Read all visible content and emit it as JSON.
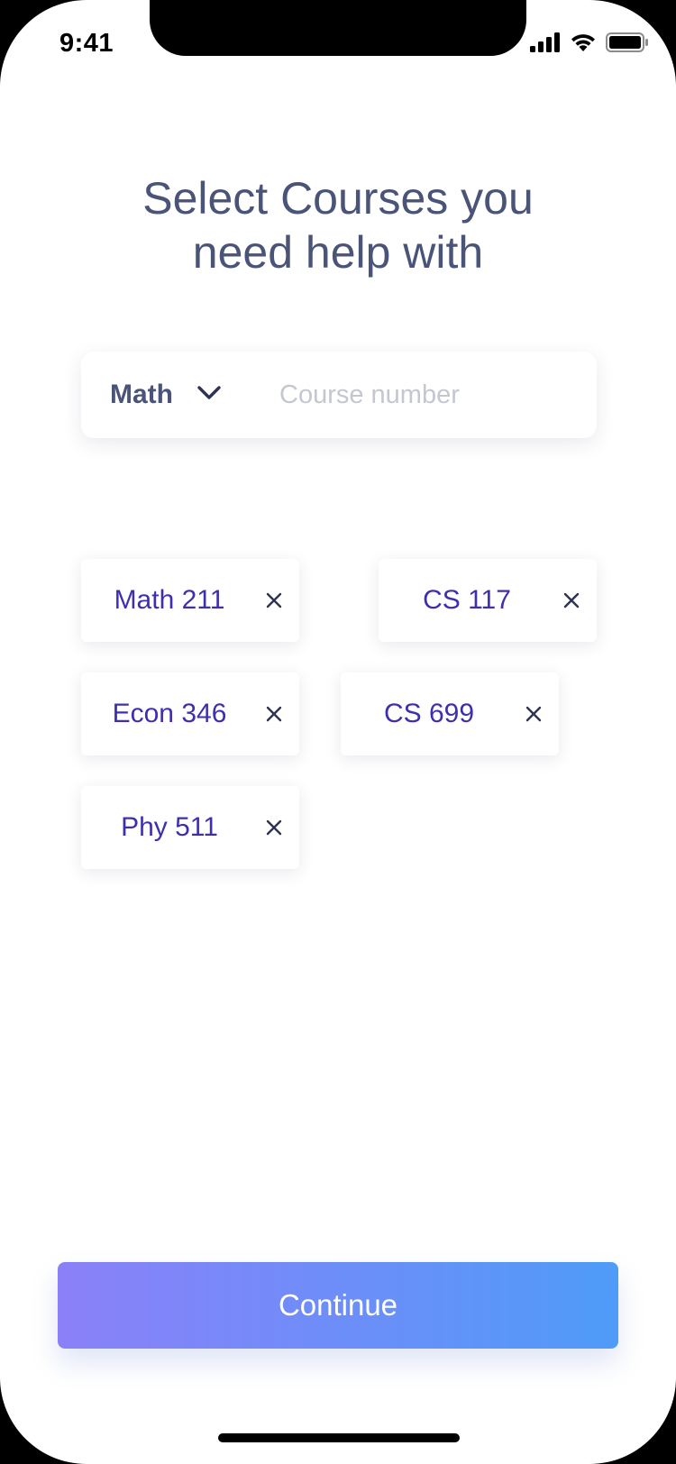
{
  "status_bar": {
    "time": "9:41",
    "icons": [
      "signal-icon",
      "wifi-icon",
      "battery-icon"
    ]
  },
  "title": {
    "line1": "Select Courses you",
    "line2": "need help with"
  },
  "search": {
    "subject_value": "Math",
    "course_placeholder": "Course number"
  },
  "selected_courses": [
    {
      "label": "Math 211"
    },
    {
      "label": "CS 117"
    },
    {
      "label": "Econ 346"
    },
    {
      "label": "CS 699"
    },
    {
      "label": "Phy 511"
    }
  ],
  "continue_label": "Continue",
  "colors": {
    "title": "#4a5478",
    "chip_text": "#3d2fb0",
    "gradient_start": "#8b80f8",
    "gradient_end": "#4f9bf8"
  }
}
